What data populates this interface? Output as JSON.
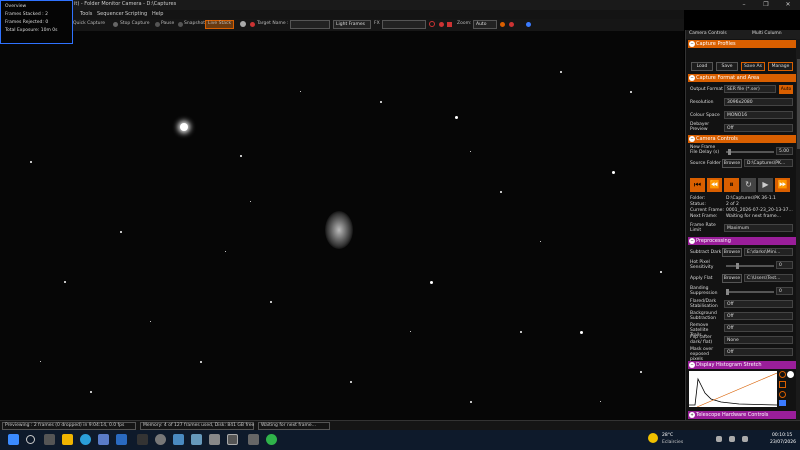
{
  "window": {
    "title": "it) - Folder Monitor Camera - D:\\Captures",
    "controls": [
      "–",
      "❐",
      "✕"
    ]
  },
  "menu": {
    "items": [
      "Tools",
      "Sequencer",
      "Scripting",
      "Help"
    ]
  },
  "toolbar": {
    "quick_capture": "Quick Capture",
    "stop_capture": "Stop Capture",
    "pause": "Pause",
    "snapshot": "Snapshot",
    "live_stack": "Live Stack",
    "target_name_label": "Target Name :",
    "target_name_value": "",
    "frame_type": "Light Frames",
    "fx_label": "FX",
    "fx_value": "",
    "zoom_label": "Zoom:",
    "zoom_value": "Auto"
  },
  "overview": {
    "title": "Overview",
    "frames_stacked": "Frames Stacked : 2",
    "frames_rejected": "Frames Rejected: 0",
    "total_exposure": "Total Exposure:      10m 0s"
  },
  "panel": {
    "tabs": [
      "Camera Controls",
      "Multi Column"
    ],
    "capture_profiles": {
      "header": "Capture Profiles",
      "buttons": [
        "Load",
        "Save",
        "Save As",
        "Manage"
      ]
    },
    "capture_format": {
      "header": "Capture Format and Area",
      "output_format_label": "Output Format",
      "output_format_value": "SER file (*.ser)",
      "auto_label": "Auto",
      "resolution_label": "Resolution",
      "resolution_value": "3096x2080",
      "colour_space_label": "Colour Space",
      "colour_space_value": "MONO16",
      "debayer_label": "Debayer Preview",
      "debayer_value": "Off"
    },
    "camera_controls": {
      "header": "Camera Controls",
      "new_frame_label": "New Frame File Delay (s)",
      "new_frame_value": "5.00",
      "source_folder_label": "Source Folder",
      "browse_label": "Browse",
      "source_folder_value": "D:\\Captures\\PK...",
      "folder_label": "Folder:",
      "folder_value": "D:\\Captures\\PK 36-1.1",
      "status_label": "Status:",
      "status_value": "2 of 2",
      "current_frame_label": "Current Frame:",
      "current_frame_value": "0001_2026-07-23_20-13-37...",
      "next_frame_label": "Next Frame:",
      "next_frame_value": "Waiting for next frame...",
      "frame_rate_label": "Frame Rate Limit",
      "frame_rate_value": "Maximum"
    },
    "preprocessing": {
      "header": "Preprocessing",
      "subtract_dark_label": "Subtract Dark",
      "subtract_dark_browse": "Browse",
      "subtract_dark_value": "E:\\darks\\Mini...",
      "hot_pixel_label": "Hot Pixel Sensitivity",
      "hot_pixel_value": "0",
      "apply_flat_label": "Apply Flat",
      "apply_flat_browse": "Browse",
      "apply_flat_value": "C:\\Users\\Test...",
      "banding_label": "Banding Suppression",
      "banding_value": "0",
      "flat_dark_label": "Flared/Dark Stabilisation",
      "flat_dark_value": "Off",
      "background_label": "Background Subtraction",
      "background_value": "Off",
      "satellite_label": "Remove Satellite Trails",
      "satellite_value": "Off",
      "flip_label": "Flip (after dark/ flat)",
      "flip_value": "None",
      "mask_label": "Mask over exposed pixels",
      "mask_value": "Off"
    },
    "histogram": {
      "header": "Display Histogram Stretch"
    },
    "telescope": {
      "header": "Telescope Hardware Controls"
    }
  },
  "status_bar": {
    "previewing": "Previewing : 2 frames (0 dropped) in 9:04:14, 0.0 fps",
    "memory": "Memory: 4 of 127 frames used, Disk: 841 GB free",
    "waiting": "Waiting for next frame..."
  },
  "taskbar": {
    "weather_temp": "28°C",
    "weather_desc": "Eclaircies",
    "time": "00:10:15",
    "date": "23/07/2026"
  },
  "colors": {
    "accent_orange": "#d95f00",
    "accent_purple": "#9a1e9a",
    "overview_border": "#2f72ff"
  }
}
